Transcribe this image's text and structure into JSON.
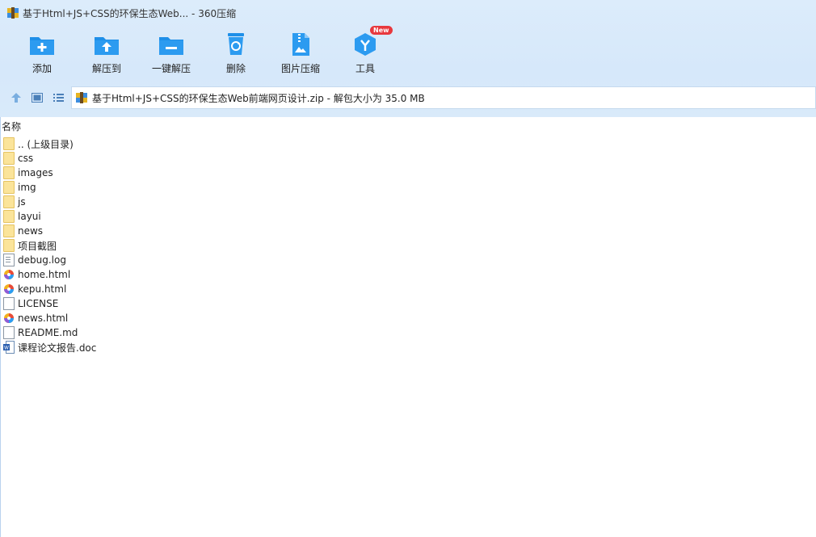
{
  "window": {
    "title": "基于Html+JS+CSS的环保生态Web... - 360压缩"
  },
  "toolbar": {
    "items": [
      {
        "label": "添加",
        "icon": "add-icon"
      },
      {
        "label": "解压到",
        "icon": "extract-to-icon"
      },
      {
        "label": "一键解压",
        "icon": "one-click-extract-icon"
      },
      {
        "label": "删除",
        "icon": "delete-icon"
      },
      {
        "label": "图片压缩",
        "icon": "image-compress-icon"
      },
      {
        "label": "工具",
        "icon": "tools-icon",
        "badge": "New"
      }
    ]
  },
  "address": {
    "text": "基于Html+JS+CSS的环保生态Web前端网页设计.zip - 解包大小为 35.0 MB"
  },
  "list": {
    "column_name": "名称",
    "rows": [
      {
        "name": ".. (上级目录)",
        "type": "folder"
      },
      {
        "name": "css",
        "type": "folder"
      },
      {
        "name": "images",
        "type": "folder"
      },
      {
        "name": "img",
        "type": "folder"
      },
      {
        "name": "js",
        "type": "folder"
      },
      {
        "name": "layui",
        "type": "folder"
      },
      {
        "name": "news",
        "type": "folder"
      },
      {
        "name": "项目截图",
        "type": "folder"
      },
      {
        "name": "debug.log",
        "type": "log"
      },
      {
        "name": "home.html",
        "type": "html"
      },
      {
        "name": "kepu.html",
        "type": "html"
      },
      {
        "name": "LICENSE",
        "type": "file"
      },
      {
        "name": "news.html",
        "type": "html"
      },
      {
        "name": "README.md",
        "type": "file"
      },
      {
        "name": "课程论文报告.doc",
        "type": "doc"
      }
    ]
  },
  "colors": {
    "accent_blue": "#1e8fe8",
    "toolbar_bg": "#d6e8fa",
    "badge_red": "#e8383d",
    "folder_yellow": "#fbe49a"
  }
}
